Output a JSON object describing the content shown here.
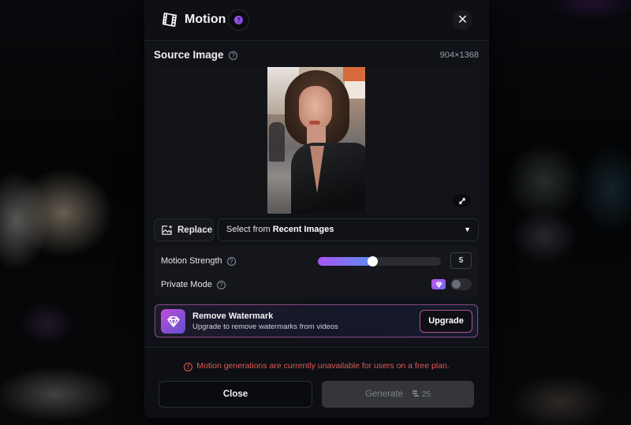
{
  "modal": {
    "title": "Motion",
    "help_icon": "question-circle-icon",
    "close_icon": "close-icon"
  },
  "source_image": {
    "label": "Source Image",
    "dimensions": "904×1368",
    "image_description": "Portrait of a woman with shoulder-length brown hair in a black leather jacket on a city street",
    "expand_icon": "expand-icon"
  },
  "actions": {
    "replace_label": "Replace",
    "recent_prefix": "Select from ",
    "recent_bold": "Recent Images"
  },
  "settings": {
    "motion_strength": {
      "label": "Motion Strength",
      "value": "5",
      "min": 1,
      "max": 10
    },
    "private_mode": {
      "label": "Private Mode",
      "enabled": false,
      "pro_badge_icon": "diamond-icon"
    }
  },
  "upsell": {
    "title": "Remove Watermark",
    "subtitle": "Upgrade to remove watermarks from videos",
    "button_label": "Upgrade"
  },
  "footer": {
    "warning": "Motion generations are currently unavailable for users on a free plan.",
    "close_label": "Close",
    "generate_label": "Generate",
    "generate_cost": "25"
  },
  "colors": {
    "accent_purple": "#a855f7",
    "accent_blue": "#5b8cf5",
    "warning_red": "#e05a56",
    "modal_bg": "#101218"
  }
}
